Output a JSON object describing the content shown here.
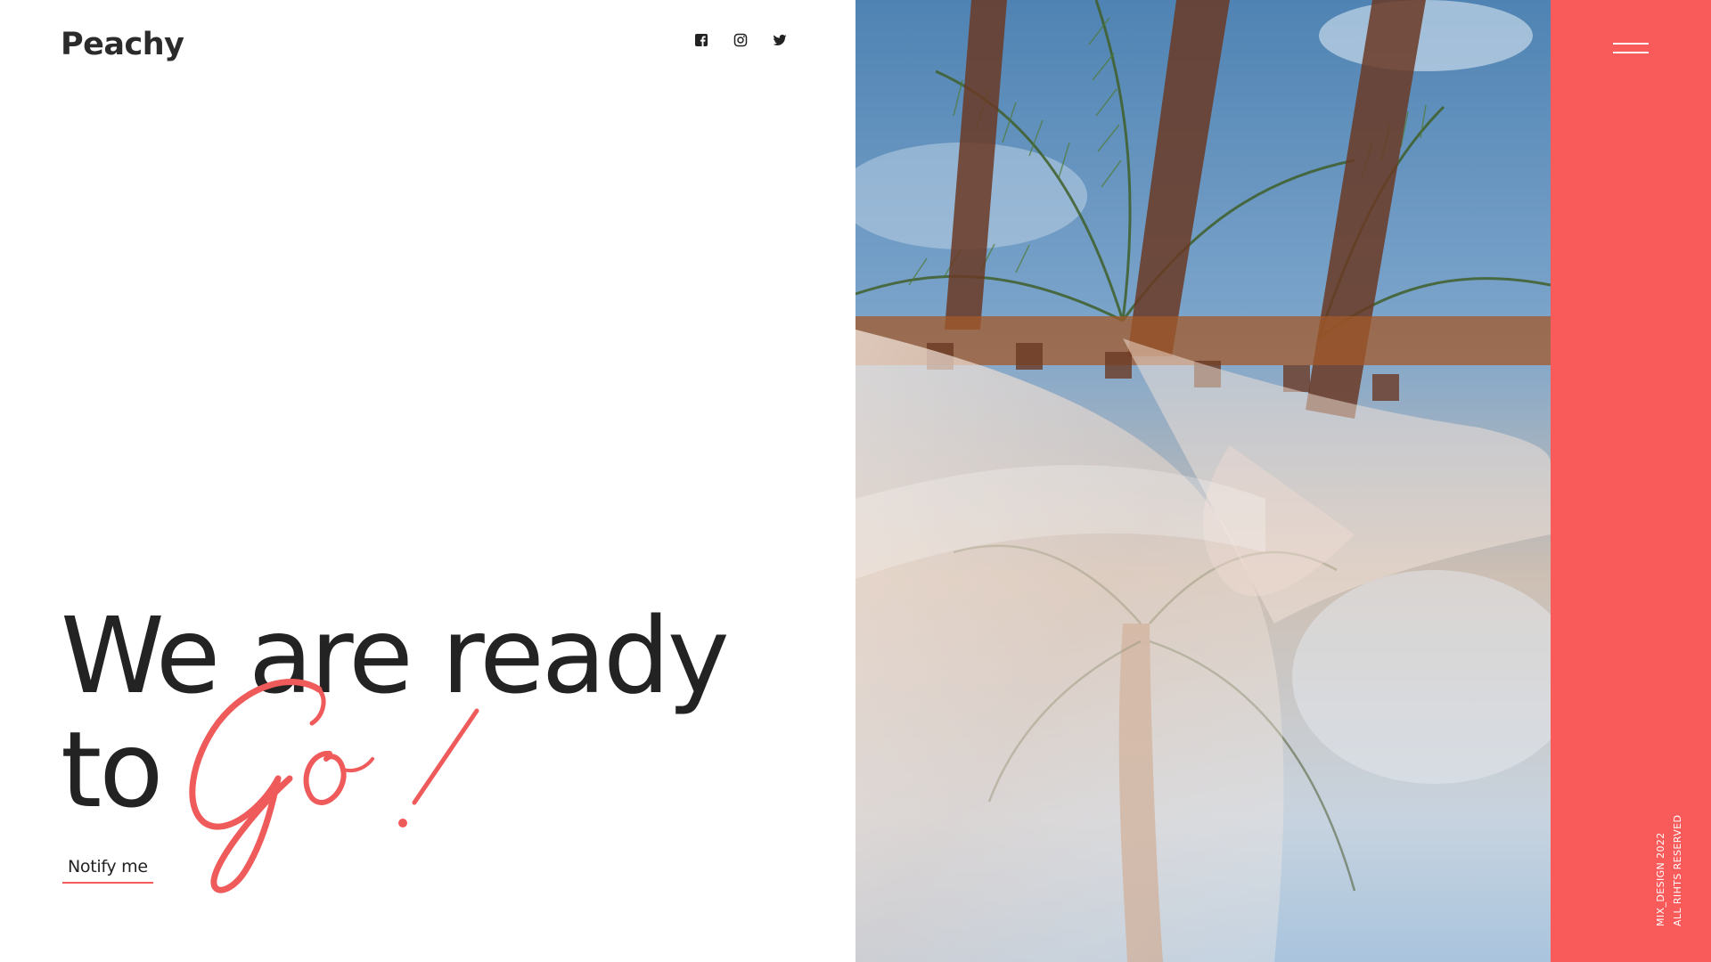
{
  "brand": {
    "logo": "Peachy"
  },
  "social": [
    {
      "name": "facebook"
    },
    {
      "name": "instagram"
    },
    {
      "name": "twitter"
    }
  ],
  "hero": {
    "line1": "We are ready",
    "line2": "to",
    "script_word": "Go!",
    "cta_label": "Notify me"
  },
  "sidebar": {
    "menu_icon": "hamburger-menu",
    "footer_line1": "MIX_DESIGN 2022",
    "footer_line2": "ALL RIHTS RESERVED"
  },
  "colors": {
    "accent": "#f95a5a",
    "text": "#232323",
    "background": "#ffffff"
  }
}
